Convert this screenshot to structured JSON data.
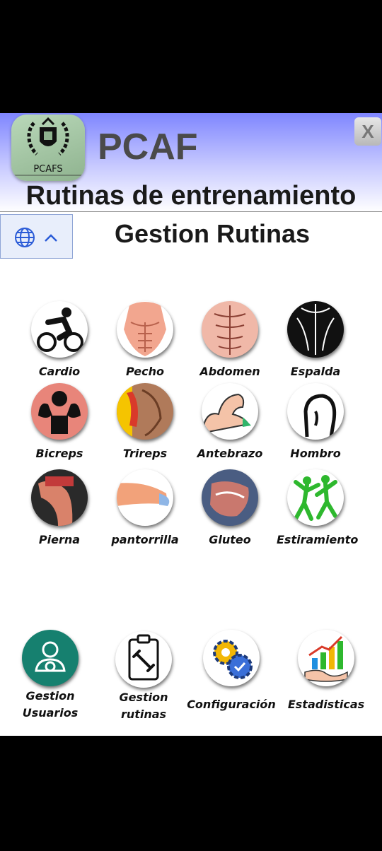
{
  "header": {
    "logo_text": "PCAFS",
    "brand": "PCAF",
    "close_label": "X",
    "title": "Rutinas de entrenamiento",
    "subtitle": "Gestion Rutinas"
  },
  "muscles": [
    {
      "label": "Cardio"
    },
    {
      "label": "Pecho"
    },
    {
      "label": "Abdomen"
    },
    {
      "label": "Espalda"
    },
    {
      "label": "Bicreps"
    },
    {
      "label": "Trireps"
    },
    {
      "label": "Antebrazo"
    },
    {
      "label": "Hombro"
    },
    {
      "label": "Pierna"
    },
    {
      "label": "pantorrilla"
    },
    {
      "label": "Gluteo"
    },
    {
      "label": "Estiramiento"
    }
  ],
  "bottom_menu": [
    {
      "line1": "Gestion",
      "line2": "Usuarios"
    },
    {
      "line1": "Gestion",
      "line2": "rutinas"
    },
    {
      "line1": "Configuración",
      "line2": ""
    },
    {
      "line1": "Estadisticas",
      "line2": ""
    }
  ],
  "colors": {
    "header_gradient_top": "#7f86ff",
    "accent_blue": "#2a5bd7",
    "teal": "#16806f"
  }
}
